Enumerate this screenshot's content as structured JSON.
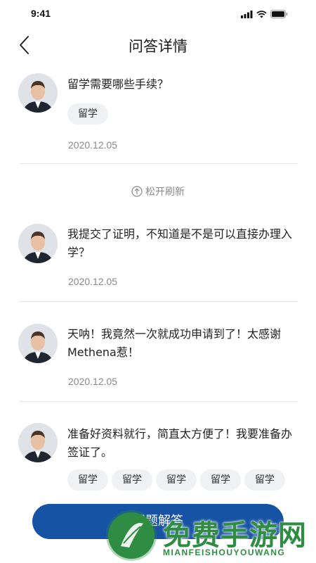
{
  "status_bar": {
    "time": "9:41"
  },
  "header": {
    "title": "问答详情"
  },
  "refresh_hint": "松开刷新",
  "posts": [
    {
      "text": "留学需要哪些手续？",
      "tags": [
        "留学"
      ],
      "date": "2020.12.05"
    },
    {
      "text": "我提交了证明，不知道是不是可以直接办理入学？",
      "tags": [],
      "date": "2020.12.05"
    },
    {
      "text": "天呐！我竟然一次就成功申请到了！太感谢Methena惹！",
      "tags": [],
      "date": "2020.12.05"
    },
    {
      "text": "准备好资料就行，简直太方便了！我要准备办签证了。",
      "tags": [
        "留学",
        "留学",
        "留学",
        "留学",
        "留学"
      ],
      "date": ""
    }
  ],
  "answer_button": {
    "label": "问题解答"
  },
  "watermark": {
    "main": "免费手游网",
    "sub": "MIANFEISHOUYOUWANG"
  },
  "colors": {
    "primary": "#1753a4",
    "tag_bg": "#f0f1f3",
    "watermark": "#2f8c43"
  }
}
